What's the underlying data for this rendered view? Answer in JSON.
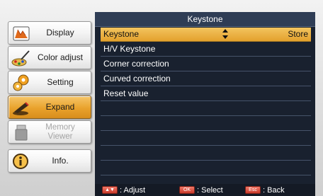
{
  "sidebar": {
    "items": [
      {
        "label": "Display",
        "icon": "display-icon",
        "state": "normal"
      },
      {
        "label": "Color adjust",
        "icon": "color-adjust-icon",
        "state": "normal"
      },
      {
        "label": "Setting",
        "icon": "setting-gears-icon",
        "state": "normal"
      },
      {
        "label": "Expand",
        "icon": "expand-icon",
        "state": "active"
      },
      {
        "label": "Memory Viewer",
        "icon": "memory-viewer-icon",
        "state": "disabled"
      },
      {
        "label": "Info.",
        "icon": "info-icon",
        "state": "normal"
      }
    ]
  },
  "panel": {
    "title": "Keystone",
    "rows": [
      {
        "label": "Keystone",
        "value": "Store",
        "selected": true
      },
      {
        "label": "H/V Keystone",
        "value": "",
        "selected": false
      },
      {
        "label": "Corner correction",
        "value": "",
        "selected": false
      },
      {
        "label": "Curved correction",
        "value": "",
        "selected": false
      },
      {
        "label": "Reset value",
        "value": "",
        "selected": false
      }
    ]
  },
  "footer": {
    "adjust": {
      "key": "▲▼",
      "text": ": Adjust"
    },
    "select": {
      "key": "OK",
      "text": ": Select"
    },
    "back": {
      "key": "Esc",
      "text": ": Back"
    }
  },
  "colors": {
    "panel_bg": "#19212f",
    "title_bg": "#2f3d55",
    "highlight": "#e9a22c",
    "key_red": "#d4473a"
  }
}
